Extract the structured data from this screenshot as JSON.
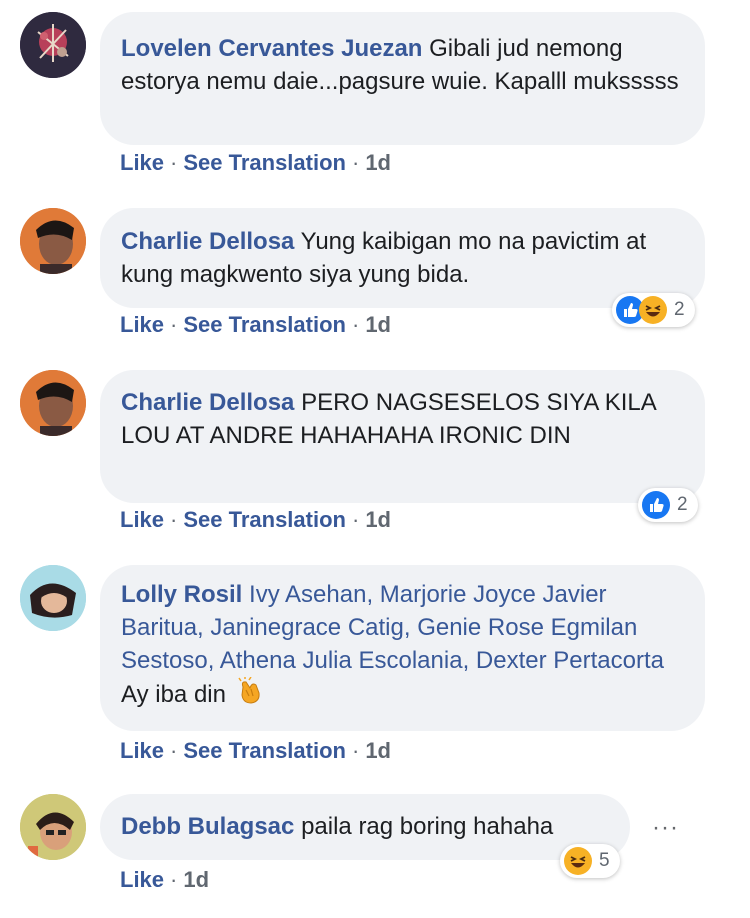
{
  "comments": [
    {
      "author": "Lovelen Cervantes Juezan",
      "text": "Gibali jud nemong estorya nemu daie...pagsure wuie. Kapalll muksssss",
      "actions": {
        "like": "Like",
        "translate": "See Translation",
        "time": "1d"
      }
    },
    {
      "author": "Charlie Dellosa",
      "text": "Yung kaibigan mo na pavictim at kung magkwento siya yung bida.",
      "actions": {
        "like": "Like",
        "translate": "See Translation",
        "time": "1d"
      },
      "reactions": {
        "icons": [
          "like-icon",
          "haha-icon"
        ],
        "count": "2"
      }
    },
    {
      "author": "Charlie Dellosa",
      "text": "PERO NAGSESELOS SIYA KILA LOU AT ANDRE HAHAHAHA IRONIC DIN",
      "actions": {
        "like": "Like",
        "translate": "See Translation",
        "time": "1d"
      },
      "reactions": {
        "icons": [
          "like-icon"
        ],
        "count": "2"
      }
    },
    {
      "author": "Lolly Rosil",
      "tags": [
        "Ivy Asehan",
        "Marjorie Joyce Javier Baritua",
        "Janinegrace Catig",
        "Genie Rose Egmilan Sestoso",
        "Athena Julia Escolania",
        "Dexter Pertacorta"
      ],
      "text": "Ay iba din",
      "emoji": "clapping-hands-icon",
      "actions": {
        "like": "Like",
        "translate": "See Translation",
        "time": "1d"
      }
    },
    {
      "author": "Debb Bulagsac",
      "text": "paila rag boring hahaha",
      "actions": {
        "like": "Like",
        "time": "1d"
      },
      "reactions": {
        "icons": [
          "haha-icon"
        ],
        "count": "5"
      },
      "more": "···"
    }
  ],
  "colors": {
    "name": "#385898",
    "bubble": "#f0f2f5",
    "like": "#1877f2",
    "haha": "#f7b125"
  }
}
